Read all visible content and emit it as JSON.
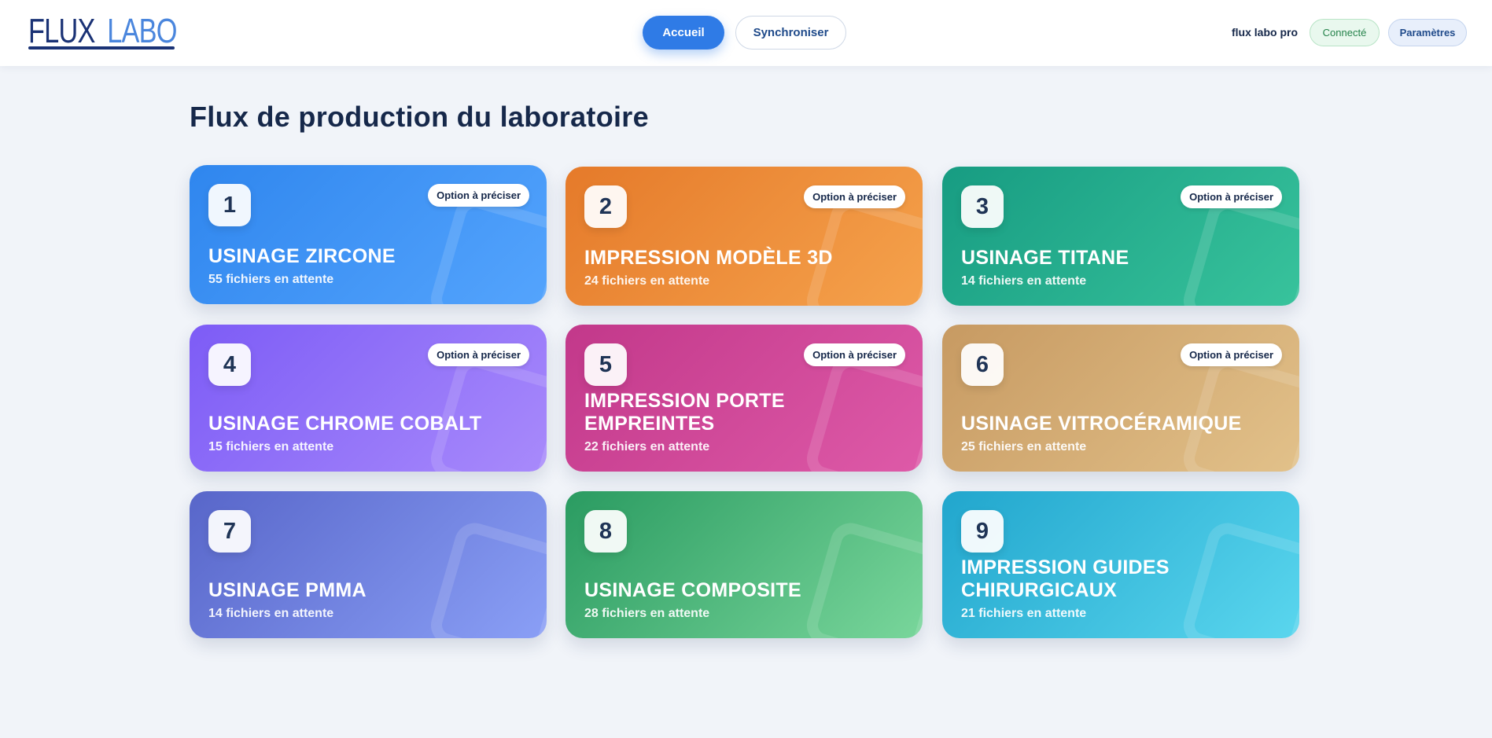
{
  "header": {
    "logo_part1": "FLUX",
    "logo_part2": "LABO",
    "nav_home": "Accueil",
    "nav_sync": "Synchroniser",
    "user_name": "flux labo pro",
    "status": "Connecté",
    "settings": "Paramètres"
  },
  "page_title": "Flux de production du laboratoire",
  "cards": [
    {
      "number": "1",
      "title": "USINAGE ZIRCONE",
      "subtitle": "55 fichiers en attente",
      "option": "Option à préciser",
      "color": "#2f86ee"
    },
    {
      "number": "2",
      "title": "IMPRESSION MODÈLE 3D",
      "subtitle": "24 fichiers en attente",
      "option": "Option à préciser",
      "color": "#e57a2a"
    },
    {
      "number": "3",
      "title": "USINAGE TITANE",
      "subtitle": "14 fichiers en attente",
      "option": "Option à préciser",
      "color": "#179c82"
    },
    {
      "number": "4",
      "title": "USINAGE CHROME COBALT",
      "subtitle": "15 fichiers en attente",
      "option": "Option à préciser",
      "color": "#7d5cf6"
    },
    {
      "number": "5",
      "title": "IMPRESSION PORTE EMPREINTES",
      "subtitle": "22 fichiers en attente",
      "option": "Option à préciser",
      "color": "#c2388a"
    },
    {
      "number": "6",
      "title": "USINAGE VITROCÉRAMIQUE",
      "subtitle": "25 fichiers en attente",
      "option": "Option à préciser",
      "color": "#c79a62"
    },
    {
      "number": "7",
      "title": "USINAGE PMMA",
      "subtitle": "14 fichiers en attente",
      "color": "#5866c9"
    },
    {
      "number": "8",
      "title": "USINAGE COMPOSITE",
      "subtitle": "28 fichiers en attente",
      "color": "#2a9b61"
    },
    {
      "number": "9",
      "title": "IMPRESSION GUIDES CHIRURGICAUX",
      "subtitle": "21 fichiers en attente",
      "color": "#21a6cd"
    }
  ]
}
